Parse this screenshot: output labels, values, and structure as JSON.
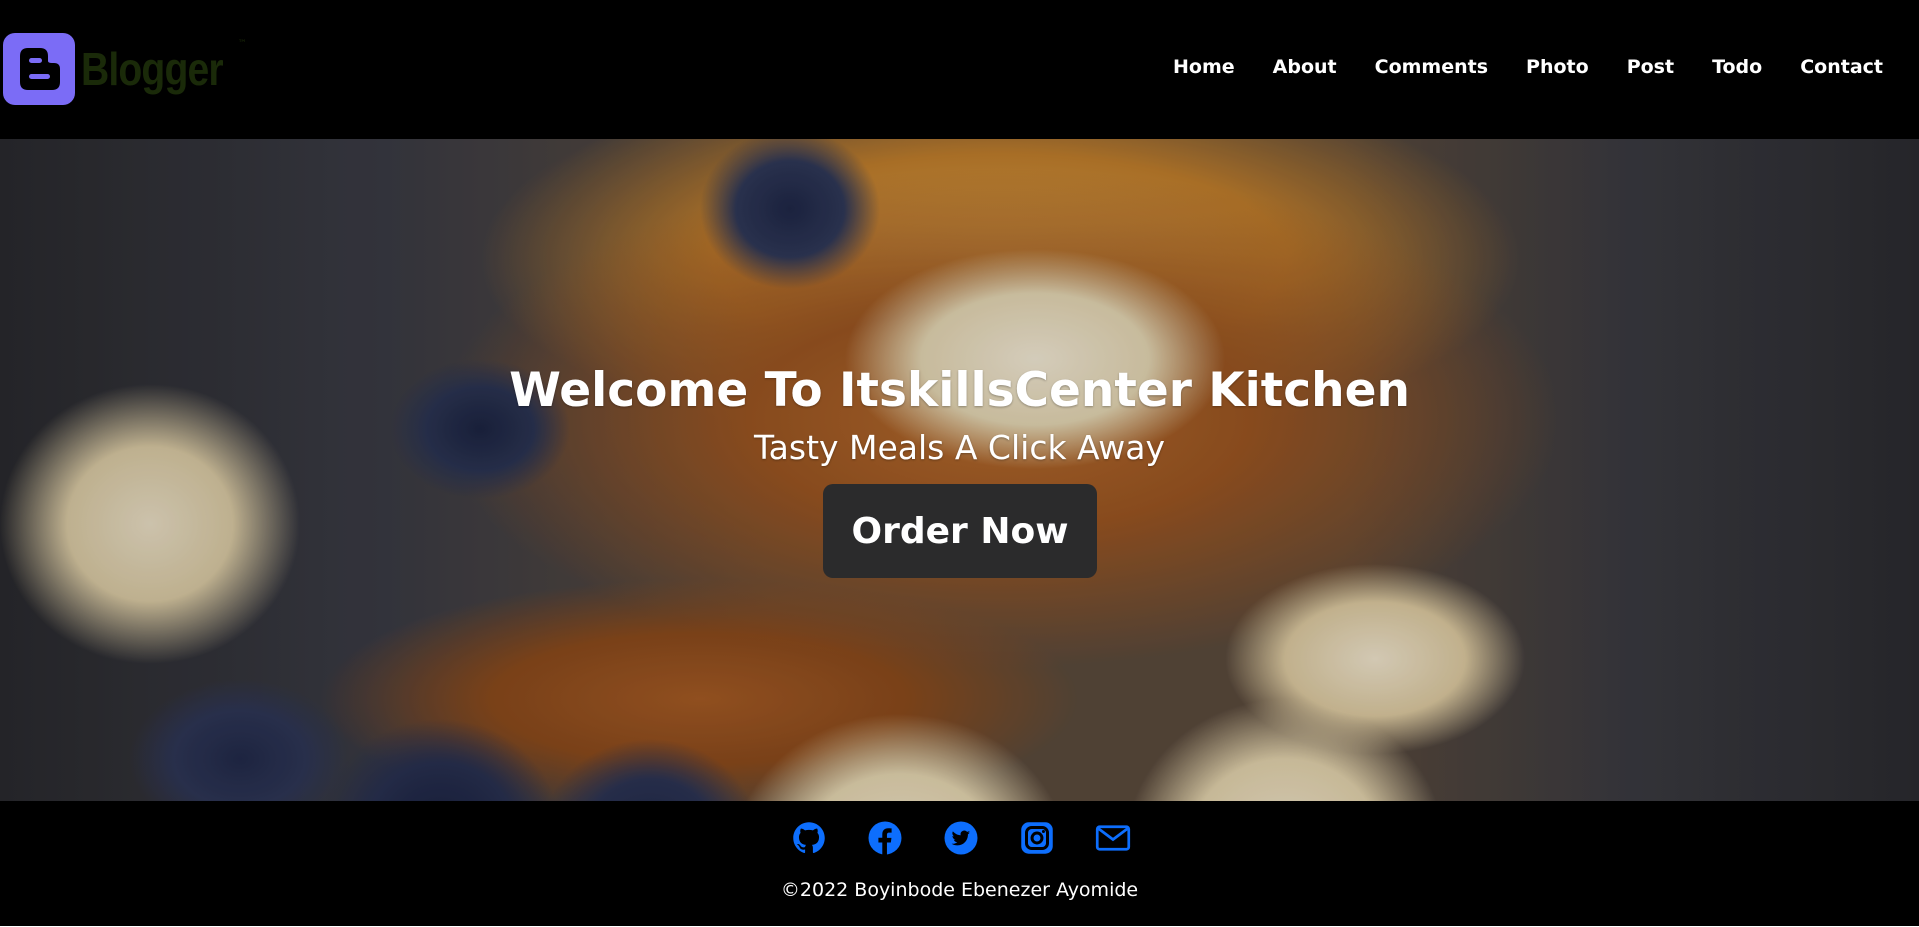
{
  "header": {
    "logo_text": "Blogger",
    "logo_tm": "™",
    "nav": [
      "Home",
      "About",
      "Comments",
      "Photo",
      "Post",
      "Todo",
      "Contact"
    ]
  },
  "hero": {
    "title": "Welcome To ItskillsCenter Kitchen",
    "subtitle": "Tasty Meals A Click Away",
    "cta_label": "Order Now"
  },
  "footer": {
    "social_icons": [
      "github-icon",
      "facebook-icon",
      "twitter-icon",
      "instagram-icon",
      "mail-icon"
    ],
    "copyright": "©2022 Boyinbode Ebenezer Ayomide"
  },
  "colors": {
    "header_bg": "#000000",
    "logo_accent": "#7b6cf6",
    "button_bg": "#2b2b2c",
    "social_icon": "#0d6efd"
  }
}
